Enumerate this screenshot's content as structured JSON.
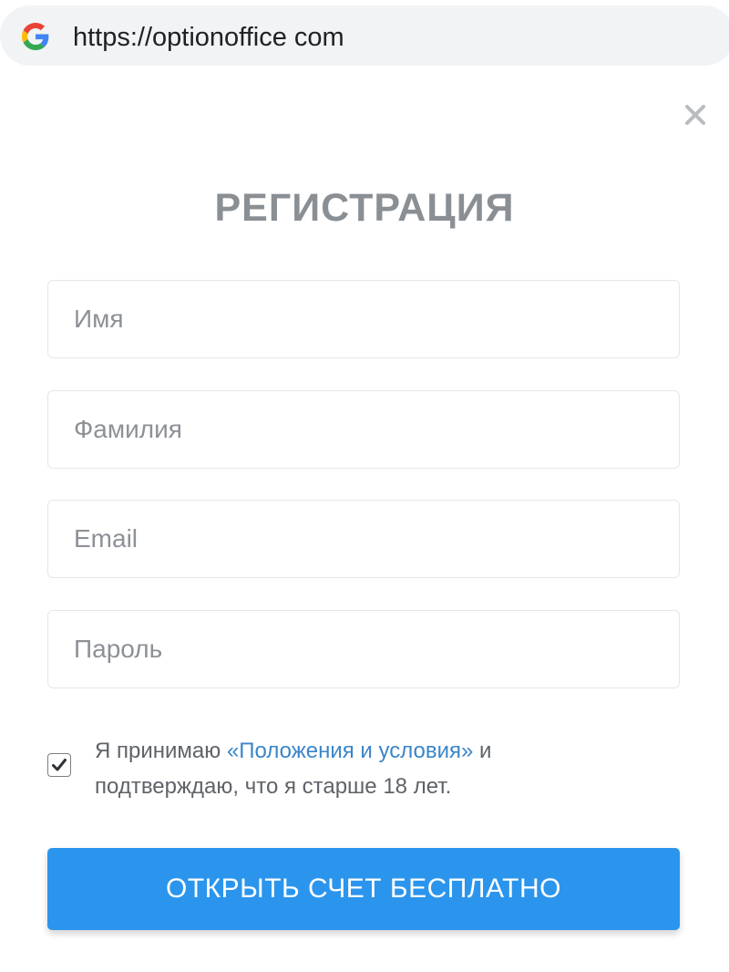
{
  "browser": {
    "url": "https://optionoffice com"
  },
  "modal": {
    "title": "РЕГИСТРАЦИЯ",
    "fields": [
      {
        "placeholder": "Имя",
        "value": ""
      },
      {
        "placeholder": "Фамилия",
        "value": ""
      },
      {
        "placeholder": "Email",
        "value": ""
      },
      {
        "placeholder": "Пароль",
        "value": ""
      }
    ],
    "consent": {
      "checked": true,
      "text_before": "Я принимаю ",
      "link_text": "«Положения и условия»",
      "text_after": " и подтверждаю, что я старше 18 лет."
    },
    "submit_label": "ОТКРЫТЬ СЧЕТ БЕСПЛАТНО"
  },
  "icons": {
    "browser": "google-g-icon",
    "close": "close-icon",
    "checkbox": "checkmark-icon"
  },
  "colors": {
    "accent": "#2b95ed",
    "link": "#3b86c8",
    "title": "#8a8f94",
    "url_bar": "#f1f3f4"
  }
}
